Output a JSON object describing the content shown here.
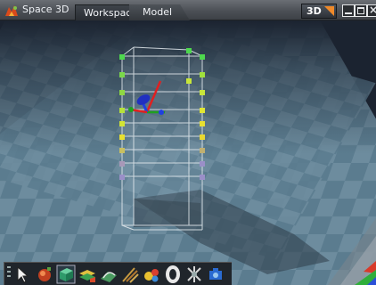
{
  "app": {
    "title": "Space 3D",
    "logo_icon": "space3d-logo-icon"
  },
  "tabs": [
    {
      "label": "Workspace",
      "active": true
    },
    {
      "label": "Model",
      "active": false
    }
  ],
  "view_mode": {
    "label": "3D",
    "accent": "#f08a2a"
  },
  "window_controls": [
    "minimize-icon",
    "maximize-icon",
    "close-icon"
  ],
  "viewport": {
    "floor_color": "#6f8fa0",
    "checker_alt_color": "#5d7f92",
    "sky_color": "#1b2330",
    "object": "wireframe box with control points and transform gizmo",
    "control_point_colors": [
      "#4ed84e",
      "#c8e63a",
      "#e8e030",
      "#9a8fc8"
    ],
    "gizmo_axes": {
      "x": "#e02020",
      "y": "#20a020",
      "z": "#2040e0"
    }
  },
  "toolbar": {
    "tools": [
      "select-arrow-icon",
      "ball-tool-icon",
      "cube-tool-icon",
      "layers-tool-icon",
      "path-tool-icon",
      "brush-tool-icon",
      "spheres-tool-icon",
      "ring-tool-icon",
      "bones-tool-icon",
      "camera-tool-icon"
    ]
  }
}
